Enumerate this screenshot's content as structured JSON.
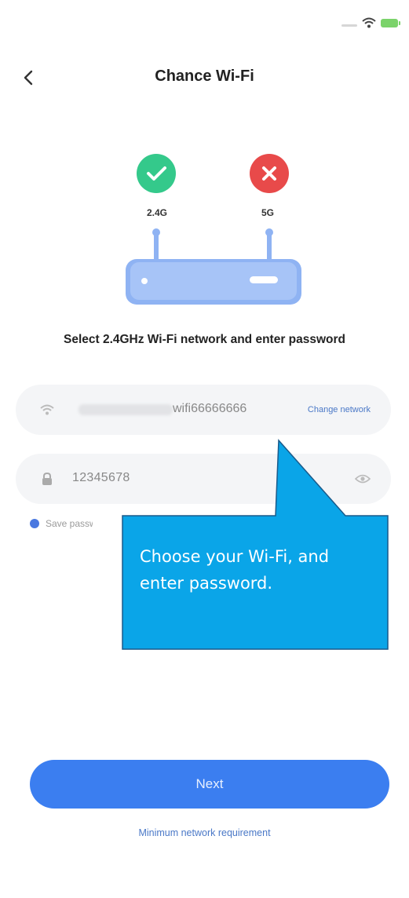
{
  "status_bar": {
    "icons": [
      "signal-icon",
      "wifi-icon",
      "battery-icon"
    ]
  },
  "header": {
    "back_icon": "chevron-left-icon",
    "title": "Chance Wi-Fi"
  },
  "router": {
    "band_24": {
      "label": "2.4G",
      "status": "supported",
      "color": "#34c98b"
    },
    "band_5": {
      "label": "5G",
      "status": "unsupported",
      "color": "#e84a4a"
    },
    "body_color": "#8fb3f3"
  },
  "instruction": "Select 2.4GHz Wi-Fi network and enter password",
  "wifi_field": {
    "icon": "wifi-icon",
    "ssid": "wifi66666666",
    "change_label": "Change network"
  },
  "password_field": {
    "icon": "lock-icon",
    "value": "12345678",
    "toggle_icon": "eye-icon"
  },
  "save_password": {
    "checked": true,
    "label": "Save passw"
  },
  "callout": {
    "text": "Choose your Wi-Fi, and enter password.",
    "color": "#0aa5e8"
  },
  "next_button": {
    "label": "Next",
    "color": "#3b7ef0"
  },
  "min_requirement_link": "Minimum network requirement"
}
